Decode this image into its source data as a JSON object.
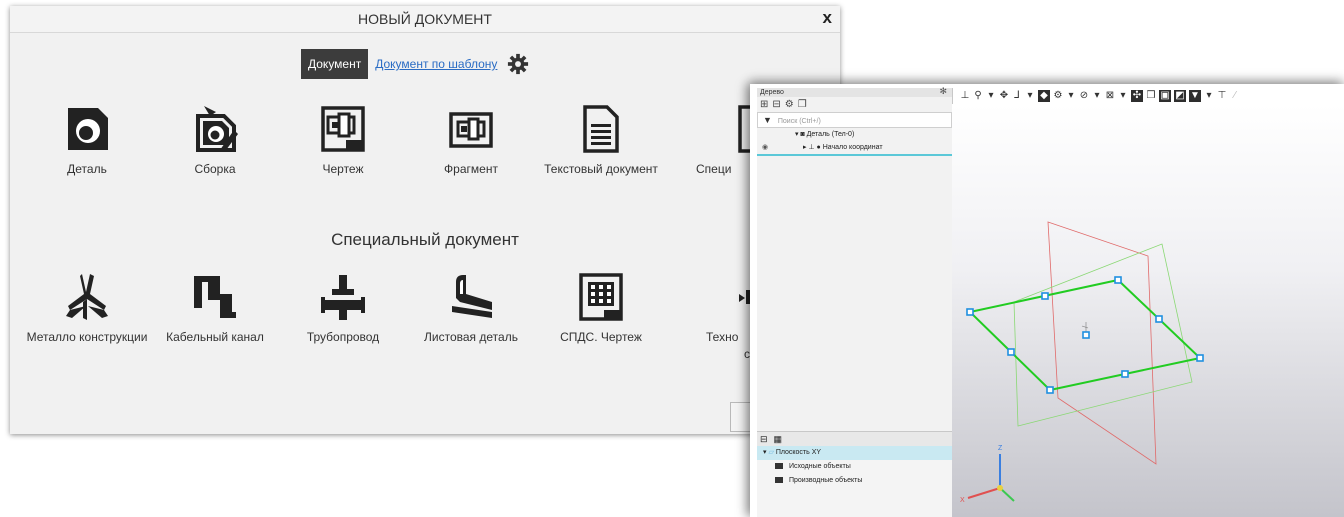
{
  "dialog": {
    "title": "НОВЫЙ ДОКУМЕНТ",
    "close_label": "x",
    "tab_active": "Документ",
    "tab_template": "Документ по шаблону",
    "items_top": [
      {
        "icon": "part-icon",
        "label": "Деталь"
      },
      {
        "icon": "assembly-icon",
        "label": "Сборка"
      },
      {
        "icon": "drawing-icon",
        "label": "Чертеж"
      },
      {
        "icon": "fragment-icon",
        "label": "Фрагмент"
      },
      {
        "icon": "text-document-icon",
        "label": "Текстовый документ"
      },
      {
        "icon": "specification-icon",
        "label": "Специ"
      }
    ],
    "section_title": "Специальный документ",
    "items_special": [
      {
        "icon": "metal-structures-icon",
        "label": "Металло конструкции"
      },
      {
        "icon": "cable-channel-icon",
        "label": "Кабельный канал"
      },
      {
        "icon": "pipeline-icon",
        "label": "Трубопровод"
      },
      {
        "icon": "sheet-part-icon",
        "label": "Листовая деталь"
      },
      {
        "icon": "spds-drawing-icon",
        "label": "СПДС. Чертеж"
      },
      {
        "icon": "technology-icon",
        "label": "Техно"
      },
      {
        "icon": "",
        "label": "с"
      }
    ]
  },
  "cad": {
    "tree_title": "Дерево",
    "search_placeholder": "Поиск (Ctrl+/)",
    "tree_rows": [
      "Деталь (Тел-0)",
      "Начало координат"
    ],
    "lower_rows": [
      "Плоскость XY",
      "Исходные объекты",
      "Производные объекты"
    ],
    "axis_x": "X",
    "axis_z": "Z"
  },
  "colors": {
    "accent_link": "#2a6cc4",
    "active_tab": "#3c3c3c",
    "selection_green": "#22cc22",
    "handle_blue": "#1f8fe0",
    "selection_row": "#c9e9f2"
  }
}
